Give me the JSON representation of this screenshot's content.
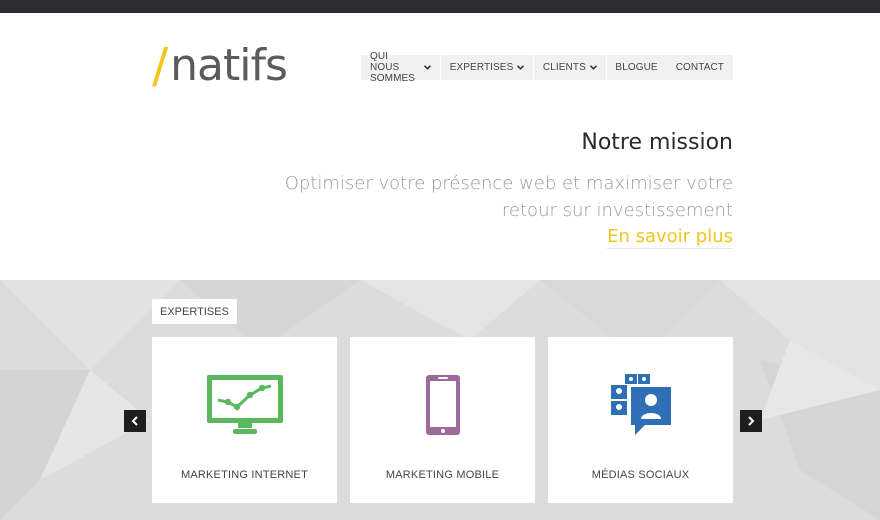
{
  "logo": {
    "slash": "/",
    "word": "natifs"
  },
  "nav": {
    "items": [
      {
        "label": "QUI NOUS SOMMES",
        "has_dropdown": true
      },
      {
        "label": "EXPERTISES",
        "has_dropdown": true
      },
      {
        "label": "CLIENTS",
        "has_dropdown": true
      },
      {
        "label": "BLOGUE",
        "has_dropdown": false
      },
      {
        "label": "CONTACT",
        "has_dropdown": false
      }
    ]
  },
  "mission": {
    "title": "Notre mission",
    "line1": "Optimiser votre présence web et maximiser votre",
    "line2": "retour sur investissement",
    "link": "En savoir plus"
  },
  "expertises": {
    "tag": "EXPERTISES",
    "cards": [
      {
        "label": "MARKETING INTERNET",
        "icon": "monitor-chart-icon",
        "color": "#5cb85c"
      },
      {
        "label": "MARKETING MOBILE",
        "icon": "smartphone-icon",
        "color": "#9c6b9c"
      },
      {
        "label": "MÉDIAS SOCIAUX",
        "icon": "social-chat-icon",
        "color": "#2f6fb5"
      }
    ]
  },
  "colors": {
    "accent": "#f4c51c",
    "topbar": "#2b2d31",
    "band": "#dcdcdc"
  }
}
